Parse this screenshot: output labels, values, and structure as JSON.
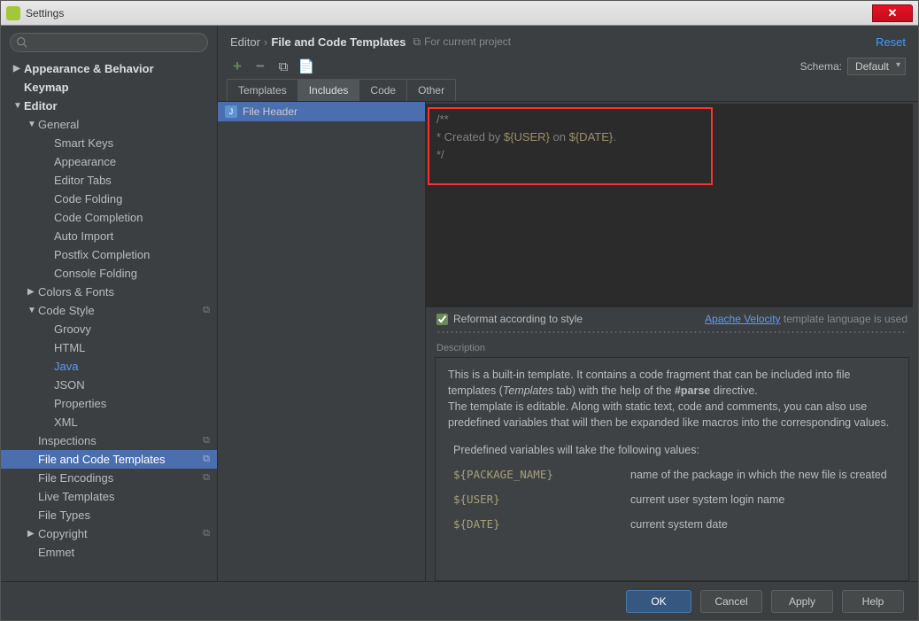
{
  "window": {
    "title": "Settings"
  },
  "sidebar": {
    "items": [
      {
        "label": "Appearance & Behavior",
        "depth": 0,
        "bold": true,
        "arrow": "▶"
      },
      {
        "label": "Keymap",
        "depth": 0,
        "bold": true,
        "arrow": ""
      },
      {
        "label": "Editor",
        "depth": 0,
        "bold": true,
        "arrow": "▼"
      },
      {
        "label": "General",
        "depth": 1,
        "arrow": "▼"
      },
      {
        "label": "Smart Keys",
        "depth": 2,
        "arrow": ""
      },
      {
        "label": "Appearance",
        "depth": 2,
        "arrow": ""
      },
      {
        "label": "Editor Tabs",
        "depth": 2,
        "arrow": ""
      },
      {
        "label": "Code Folding",
        "depth": 2,
        "arrow": ""
      },
      {
        "label": "Code Completion",
        "depth": 2,
        "arrow": ""
      },
      {
        "label": "Auto Import",
        "depth": 2,
        "arrow": ""
      },
      {
        "label": "Postfix Completion",
        "depth": 2,
        "arrow": ""
      },
      {
        "label": "Console Folding",
        "depth": 2,
        "arrow": ""
      },
      {
        "label": "Colors & Fonts",
        "depth": 1,
        "arrow": "▶"
      },
      {
        "label": "Code Style",
        "depth": 1,
        "arrow": "▼",
        "copy": true
      },
      {
        "label": "Groovy",
        "depth": 2,
        "arrow": ""
      },
      {
        "label": "HTML",
        "depth": 2,
        "arrow": ""
      },
      {
        "label": "Java",
        "depth": 2,
        "arrow": "",
        "blue": true
      },
      {
        "label": "JSON",
        "depth": 2,
        "arrow": ""
      },
      {
        "label": "Properties",
        "depth": 2,
        "arrow": ""
      },
      {
        "label": "XML",
        "depth": 2,
        "arrow": ""
      },
      {
        "label": "Inspections",
        "depth": 1,
        "arrow": "",
        "copy": true
      },
      {
        "label": "File and Code Templates",
        "depth": 1,
        "arrow": "",
        "sel": true,
        "copy": true
      },
      {
        "label": "File Encodings",
        "depth": 1,
        "arrow": "",
        "copy": true
      },
      {
        "label": "Live Templates",
        "depth": 1,
        "arrow": ""
      },
      {
        "label": "File Types",
        "depth": 1,
        "arrow": ""
      },
      {
        "label": "Copyright",
        "depth": 1,
        "arrow": "▶",
        "copy": true
      },
      {
        "label": "Emmet",
        "depth": 1,
        "arrow": ""
      }
    ]
  },
  "breadcrumb": {
    "root": "Editor",
    "leaf": "File and Code Templates",
    "context": "For current project",
    "reset": "Reset"
  },
  "schema": {
    "label": "Schema:",
    "value": "Default"
  },
  "tabs": [
    "Templates",
    "Includes",
    "Code",
    "Other"
  ],
  "active_tab_index": 1,
  "template_list": {
    "selected": "File Header"
  },
  "editor": {
    "line1": "/**",
    "line2_a": " * Created by ",
    "line2_var1": "${USER}",
    "line2_b": " on ",
    "line2_var2": "${DATE}",
    "line2_c": ".",
    "line3": " */"
  },
  "reformat": {
    "label": "Reformat according to style",
    "checked": true
  },
  "velocity": {
    "link": "Apache Velocity",
    "suffix": " template language is used"
  },
  "desc": {
    "title": "Description",
    "p1a": "This is a built-in template. It contains a code fragment that can be included into file templates (",
    "p1i": "Templates",
    "p1b": " tab) with the help of the ",
    "p1bold": "#parse",
    "p1c": " directive.",
    "p2": "The template is editable. Along with static text, code and comments, you can also use predefined variables that will then be expanded like macros into the corresponding values.",
    "intro": "Predefined variables will take the following values:",
    "vars": [
      {
        "name": "${PACKAGE_NAME}",
        "desc": "name of the package in which the new file is created"
      },
      {
        "name": "${USER}",
        "desc": "current user system login name"
      },
      {
        "name": "${DATE}",
        "desc": "current system date"
      }
    ]
  },
  "footer": {
    "ok": "OK",
    "cancel": "Cancel",
    "apply": "Apply",
    "help": "Help"
  }
}
